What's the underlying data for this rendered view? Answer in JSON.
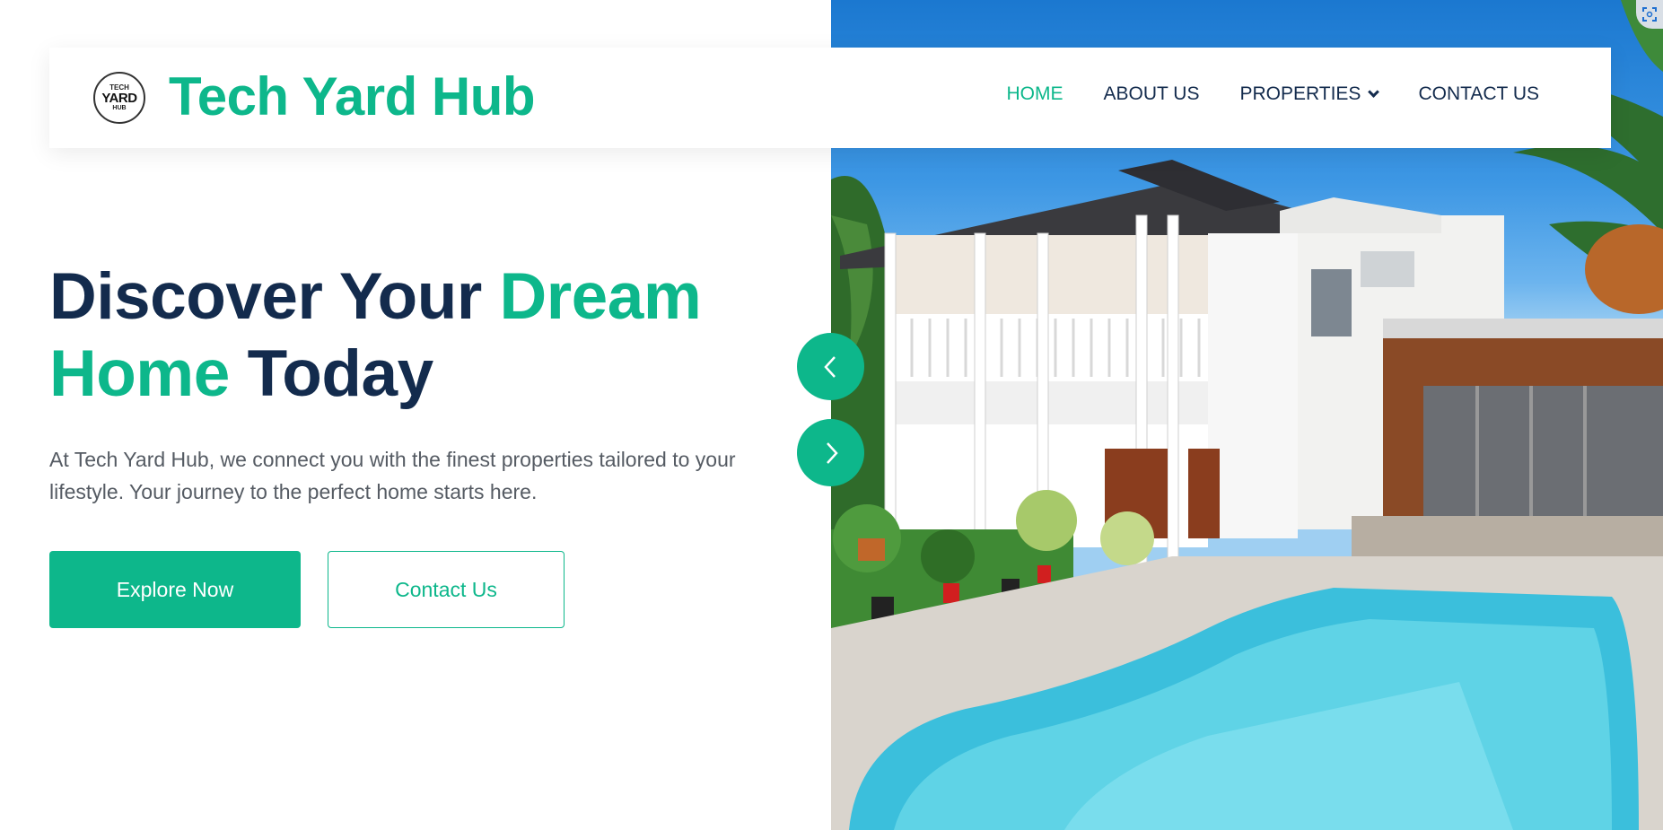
{
  "colors": {
    "accent": "#0db78b",
    "navy": "#132b4d",
    "body_text": "#555b63"
  },
  "brand": {
    "logo_lines": [
      "TECH",
      "YARD",
      "HUB"
    ],
    "name": "Tech Yard Hub"
  },
  "nav": {
    "items": [
      {
        "label": "HOME",
        "active": true
      },
      {
        "label": "ABOUT US",
        "active": false
      },
      {
        "label": "PROPERTIES",
        "active": false,
        "icon": "chevron-down-icon"
      },
      {
        "label": "CONTACT US",
        "active": false
      }
    ]
  },
  "hero": {
    "title_part1": "Discover Your ",
    "title_accent1": "Dream",
    "title_accent2": "Home",
    "title_part2": " Today",
    "description": "At Tech Yard Hub, we connect you with the finest properties tailored to your lifestyle. Your journey to the perfect home starts here.",
    "primary_button": "Explore Now",
    "secondary_button": "Contact Us"
  },
  "slider": {
    "prev_icon": "chevron-left-icon",
    "next_icon": "chevron-right-icon"
  }
}
